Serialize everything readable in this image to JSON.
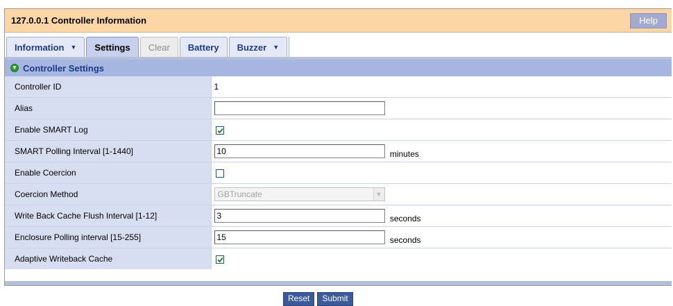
{
  "header": {
    "title": "127.0.0.1 Controller Information",
    "help_label": "Help"
  },
  "tabs": [
    {
      "label": "Information",
      "has_dropdown": true,
      "state": "normal"
    },
    {
      "label": "Settings",
      "has_dropdown": false,
      "state": "active"
    },
    {
      "label": "Clear",
      "has_dropdown": false,
      "state": "disabled"
    },
    {
      "label": "Battery",
      "has_dropdown": false,
      "state": "normal"
    },
    {
      "label": "Buzzer",
      "has_dropdown": true,
      "state": "normal"
    }
  ],
  "section": {
    "title": "Controller Settings",
    "icon": "chevron-down-circle-icon"
  },
  "fields": {
    "controller_id": {
      "label": "Controller ID",
      "value": "1"
    },
    "alias": {
      "label": "Alias",
      "value": ""
    },
    "enable_smart_log": {
      "label": "Enable SMART Log",
      "checked": true
    },
    "smart_polling_interval": {
      "label": "SMART Polling Interval [1-1440]",
      "value": "10",
      "unit": "minutes"
    },
    "enable_coercion": {
      "label": "Enable Coercion",
      "checked": false
    },
    "coercion_method": {
      "label": "Coercion Method",
      "value": "GBTruncate",
      "disabled": true
    },
    "write_back_cache_flush_interval": {
      "label": "Write Back Cache Flush Interval [1-12]",
      "value": "3",
      "unit": "seconds"
    },
    "enclosure_polling_interval": {
      "label": "Enclosure Polling interval [15-255]",
      "value": "15",
      "unit": "seconds"
    },
    "adaptive_writeback_cache": {
      "label": "Adaptive Writeback Cache",
      "checked": true
    }
  },
  "actions": {
    "reset_label": "Reset",
    "submit_label": "Submit"
  },
  "colors": {
    "title_bar": "#fcd6a4",
    "section_header": "#a7b6e0",
    "label_column": "#d7def2",
    "tab_text": "#1c3a8c",
    "button": "#3b5a9c",
    "check": "#2c8a2c"
  }
}
